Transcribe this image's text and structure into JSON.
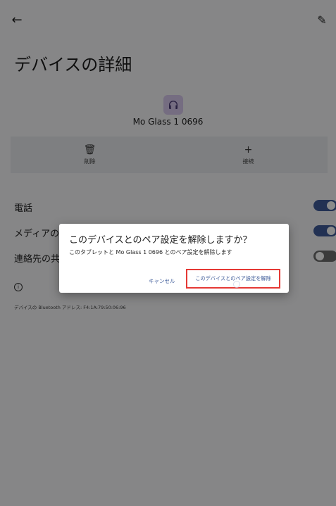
{
  "header": {
    "back_icon": "arrow-left-icon",
    "edit_icon": "pencil-icon",
    "title": "デバイスの詳細"
  },
  "device": {
    "icon": "headphones-icon",
    "name": "Mo Glass 1 0696"
  },
  "actions": [
    {
      "icon": "trash-icon",
      "glyph": "🗑",
      "label": "削除"
    },
    {
      "icon": "plus-icon",
      "glyph": "+",
      "label": "接続"
    }
  ],
  "settings": [
    {
      "label": "電話",
      "enabled": true
    },
    {
      "label": "メディアの音声",
      "enabled": true
    },
    {
      "label": "連絡先の共有",
      "enabled": false
    }
  ],
  "info": {
    "icon": "info-icon",
    "address_text": "デバイスの Bluetooth アドレス: F4:1A:79:50:06:96"
  },
  "dialog": {
    "title": "このデバイスとのペア設定を解除しますか？",
    "message": "このタブレットと Mo Glass 1 0696 とのペア設定を解除します",
    "cancel_label": "キャンセル",
    "confirm_label": "このデバイスとのペア設定を解除"
  },
  "colors": {
    "accent": "#3f5c9a",
    "highlight_border": "#e53935",
    "scrim": "rgba(0,0,0,0.46)"
  }
}
